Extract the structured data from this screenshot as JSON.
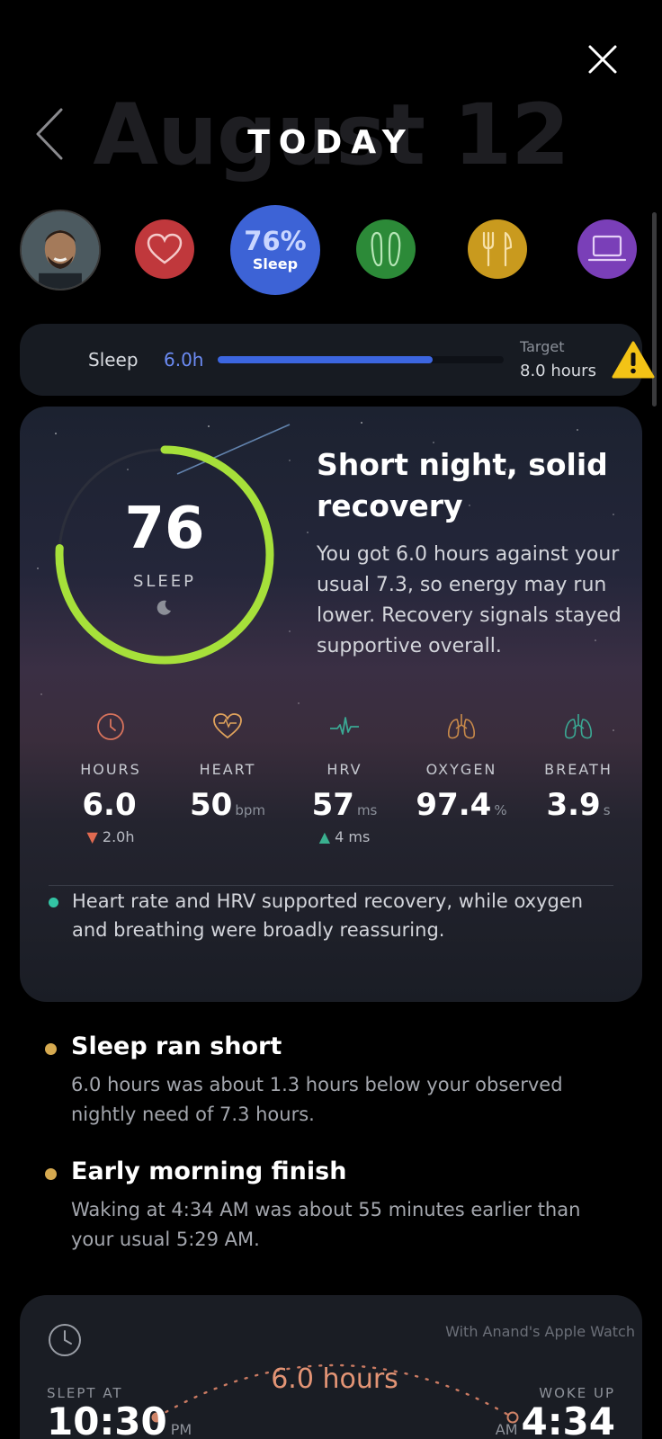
{
  "header": {
    "background_date": "August 12",
    "title": "TODAY"
  },
  "categories": [
    {
      "name": "profile-avatar"
    },
    {
      "name": "heart-icon"
    },
    {
      "percent": "76%",
      "label": "Sleep",
      "color": "#3d63d6"
    },
    {
      "name": "footsteps-icon"
    },
    {
      "name": "fork-knife-icon"
    },
    {
      "name": "laptop-icon"
    }
  ],
  "sleep_bar": {
    "label": "Sleep",
    "value": "6.0h",
    "progress_fraction": 0.75,
    "target_label": "Target",
    "target_value": "8.0 hours"
  },
  "hero": {
    "score": "76",
    "score_label": "SLEEP",
    "score_fraction": 0.76,
    "title": "Short night, solid recovery",
    "body": "You got 6.0 hours against your usual 7.3, so energy may run lower. Recovery signals stayed supportive overall.",
    "ring_color": "#a6e03a",
    "metrics": [
      {
        "icon": "clock-icon",
        "name": "HOURS",
        "value": "6.0",
        "unit": "",
        "delta": "▼ 2.0h"
      },
      {
        "icon": "heart-icon",
        "name": "HEART",
        "value": "50",
        "unit": "bpm",
        "delta": ""
      },
      {
        "icon": "pulse-icon",
        "name": "HRV",
        "value": "57",
        "unit": "ms",
        "delta": "▲ 4 ms"
      },
      {
        "icon": "lungs-icon",
        "name": "OXYGEN",
        "value": "97.4",
        "unit": "%",
        "delta": ""
      },
      {
        "icon": "lungs-icon",
        "name": "BREATH",
        "value": "3.9",
        "unit": "s",
        "delta": ""
      }
    ],
    "note": "Heart rate and HRV supported recovery, while oxygen and breathing were broadly reassuring."
  },
  "insights": [
    {
      "title": "Sleep ran short",
      "text": "6.0 hours was about 1.3 hours below your observed nightly need of 7.3 hours."
    },
    {
      "title": "Early morning finish",
      "text": "Waking at 4:34 AM was about 55 minutes earlier than your usual 5:29 AM."
    }
  ],
  "times": {
    "source": "With Anand's Apple Watch",
    "duration": "6.0 hours",
    "slept_label": "SLEPT AT",
    "slept_time": "10:30",
    "slept_ampm": "PM",
    "woke_label": "WOKE UP",
    "woke_time": "4:34",
    "woke_ampm": "AM"
  }
}
